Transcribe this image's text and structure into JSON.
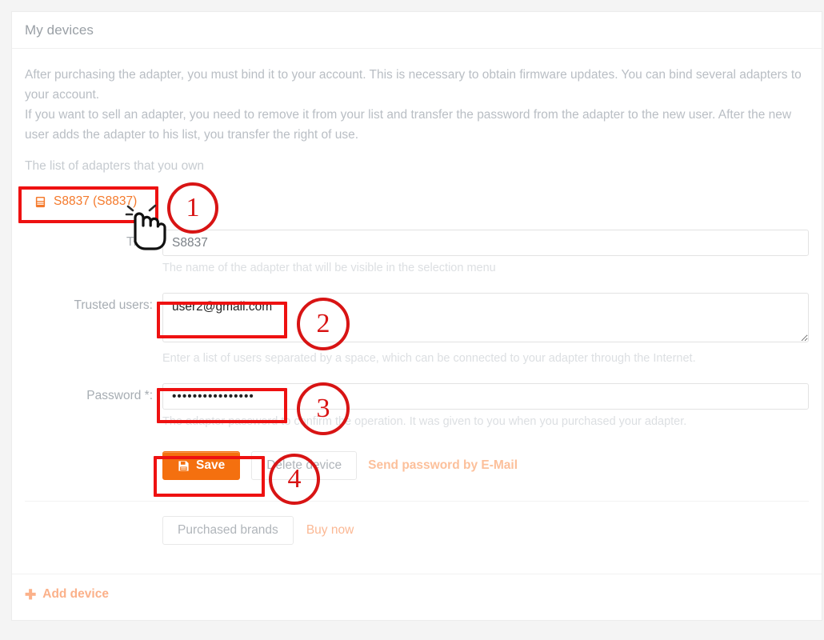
{
  "panel": {
    "title": "My devices",
    "intro_line1": "After purchasing the adapter, you must bind it to your account. This is necessary to obtain firmware updates. You can bind several adapters to your account.",
    "intro_line2": "If you want to sell an adapter, you need to remove it from your list and transfer the password from the adapter to the new user. After the new user adds the adapter to his list, you transfer the right of use.",
    "subnote": "The list of adapters that you own"
  },
  "tabs": [
    {
      "label": "S8837 (S8837)",
      "icon": "hdd-icon"
    }
  ],
  "form": {
    "title": {
      "label": "Title:",
      "value": "S8837",
      "placeholder": "",
      "helper": "The name of the adapter that will be visible in the selection menu"
    },
    "trusted_users": {
      "label": "Trusted users:",
      "value": "user2@gmail.com",
      "placeholder": "",
      "helper": "Enter a list of users separated by a space, which can be connected to your adapter through the Internet."
    },
    "password": {
      "label": "Password *:",
      "value": "••••••••••••••••",
      "placeholder": "",
      "helper": "The adapter password to confirm the operation. It was given to you when you purchased your adapter."
    }
  },
  "buttons": {
    "save": "Save",
    "save_icon": "floppy-disk-icon",
    "delete_device": "Delete device",
    "send_password": "Send password by E-Mail",
    "purchased_brands": "Purchased brands",
    "buy_now": "Buy now",
    "add_device": "Add device",
    "add_device_icon": "plus-icon"
  },
  "annotations": [
    {
      "number": "1"
    },
    {
      "number": "2"
    },
    {
      "number": "3"
    },
    {
      "number": "4"
    }
  ],
  "colors": {
    "accent": "#f4700f",
    "annotation_red": "#ee1111",
    "muted_text": "#b9bec4"
  }
}
